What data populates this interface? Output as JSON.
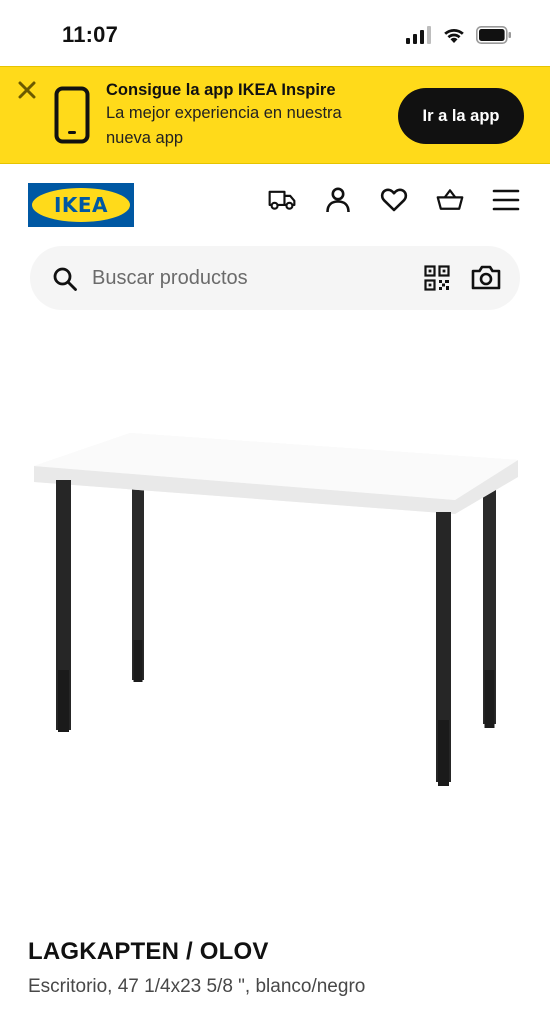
{
  "status_bar": {
    "time": "11:07",
    "icons": [
      "signal-icon",
      "wifi-icon",
      "battery-icon"
    ]
  },
  "app_banner": {
    "title": "Consigue la app IKEA Inspire",
    "subtitle": "La mejor experiencia en nuestra nueva app",
    "button_label": "Ir a la app",
    "background_color": "#FFDA1A"
  },
  "header": {
    "logo_text": "IKEA",
    "brand_colors": {
      "blue": "#0058A3",
      "yellow": "#FFDA1A"
    },
    "nav_icons": [
      "delivery-truck-icon",
      "user-icon",
      "heart-icon",
      "basket-icon",
      "menu-icon"
    ]
  },
  "search": {
    "placeholder": "Buscar productos",
    "value": "",
    "icons": [
      "search-icon",
      "qr-code-icon",
      "camera-icon"
    ]
  },
  "product": {
    "name": "LAGKAPTEN / OLOV",
    "description": "Escritorio, 47 1/4x23 5/8 \", blanco/negro"
  }
}
